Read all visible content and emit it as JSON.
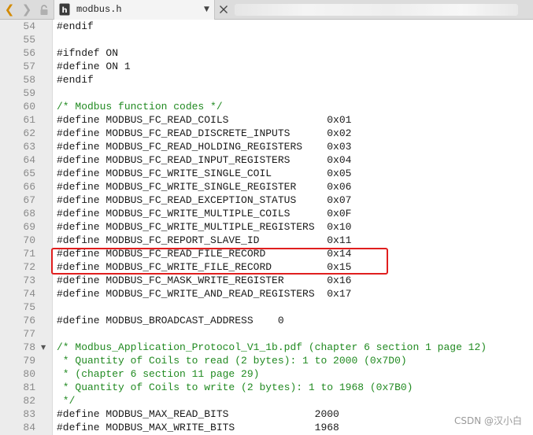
{
  "tab": {
    "filename": "modbus.h"
  },
  "icons": {
    "back": "back-arrow-icon",
    "forward": "forward-arrow-icon",
    "lock": "lock-icon",
    "file": "header-file-icon",
    "dropdown": "chevron-down-icon",
    "close": "close-icon",
    "fold": "fold-collapse-icon"
  },
  "colors": {
    "keyword_text": "#1a1a1a",
    "comment": "#218a21",
    "line_number": "#8a8a8a",
    "highlight_box": "#e01e1e",
    "back_arrow": "#d38a00"
  },
  "editor": {
    "lines": [
      {
        "num": "54",
        "text": "#endif",
        "type": "code"
      },
      {
        "num": "55",
        "text": "",
        "type": "code"
      },
      {
        "num": "56",
        "text": "#ifndef ON",
        "type": "code"
      },
      {
        "num": "57",
        "text": "#define ON 1",
        "type": "code"
      },
      {
        "num": "58",
        "text": "#endif",
        "type": "code"
      },
      {
        "num": "59",
        "text": "",
        "type": "code"
      },
      {
        "num": "60",
        "text": "/* Modbus function codes */",
        "type": "comment"
      },
      {
        "num": "61",
        "text": "#define MODBUS_FC_READ_COILS                0x01",
        "type": "code"
      },
      {
        "num": "62",
        "text": "#define MODBUS_FC_READ_DISCRETE_INPUTS      0x02",
        "type": "code"
      },
      {
        "num": "63",
        "text": "#define MODBUS_FC_READ_HOLDING_REGISTERS    0x03",
        "type": "code"
      },
      {
        "num": "64",
        "text": "#define MODBUS_FC_READ_INPUT_REGISTERS      0x04",
        "type": "code"
      },
      {
        "num": "65",
        "text": "#define MODBUS_FC_WRITE_SINGLE_COIL         0x05",
        "type": "code"
      },
      {
        "num": "66",
        "text": "#define MODBUS_FC_WRITE_SINGLE_REGISTER     0x06",
        "type": "code"
      },
      {
        "num": "67",
        "text": "#define MODBUS_FC_READ_EXCEPTION_STATUS     0x07",
        "type": "code"
      },
      {
        "num": "68",
        "text": "#define MODBUS_FC_WRITE_MULTIPLE_COILS      0x0F",
        "type": "code"
      },
      {
        "num": "69",
        "text": "#define MODBUS_FC_WRITE_MULTIPLE_REGISTERS  0x10",
        "type": "code"
      },
      {
        "num": "70",
        "text": "#define MODBUS_FC_REPORT_SLAVE_ID           0x11",
        "type": "code"
      },
      {
        "num": "71",
        "text": "#define MODBUS_FC_READ_FILE_RECORD          0x14",
        "type": "code"
      },
      {
        "num": "72",
        "text": "#define MODBUS_FC_WRITE_FILE_RECORD         0x15",
        "type": "code"
      },
      {
        "num": "73",
        "text": "#define MODBUS_FC_MASK_WRITE_REGISTER       0x16",
        "type": "code"
      },
      {
        "num": "74",
        "text": "#define MODBUS_FC_WRITE_AND_READ_REGISTERS  0x17",
        "type": "code"
      },
      {
        "num": "75",
        "text": "",
        "type": "code"
      },
      {
        "num": "76",
        "text": "#define MODBUS_BROADCAST_ADDRESS    0",
        "type": "code"
      },
      {
        "num": "77",
        "text": "",
        "type": "code"
      },
      {
        "num": "78",
        "text": "/* Modbus_Application_Protocol_V1_1b.pdf (chapter 6 section 1 page 12)",
        "type": "comment",
        "fold": true
      },
      {
        "num": "79",
        "text": " * Quantity of Coils to read (2 bytes): 1 to 2000 (0x7D0)",
        "type": "comment"
      },
      {
        "num": "80",
        "text": " * (chapter 6 section 11 page 29)",
        "type": "comment"
      },
      {
        "num": "81",
        "text": " * Quantity of Coils to write (2 bytes): 1 to 1968 (0x7B0)",
        "type": "comment"
      },
      {
        "num": "82",
        "text": " */",
        "type": "comment"
      },
      {
        "num": "83",
        "text": "#define MODBUS_MAX_READ_BITS              2000",
        "type": "code"
      },
      {
        "num": "84",
        "text": "#define MODBUS_MAX_WRITE_BITS             1968",
        "type": "code"
      }
    ]
  },
  "watermark": "CSDN @汉小白"
}
